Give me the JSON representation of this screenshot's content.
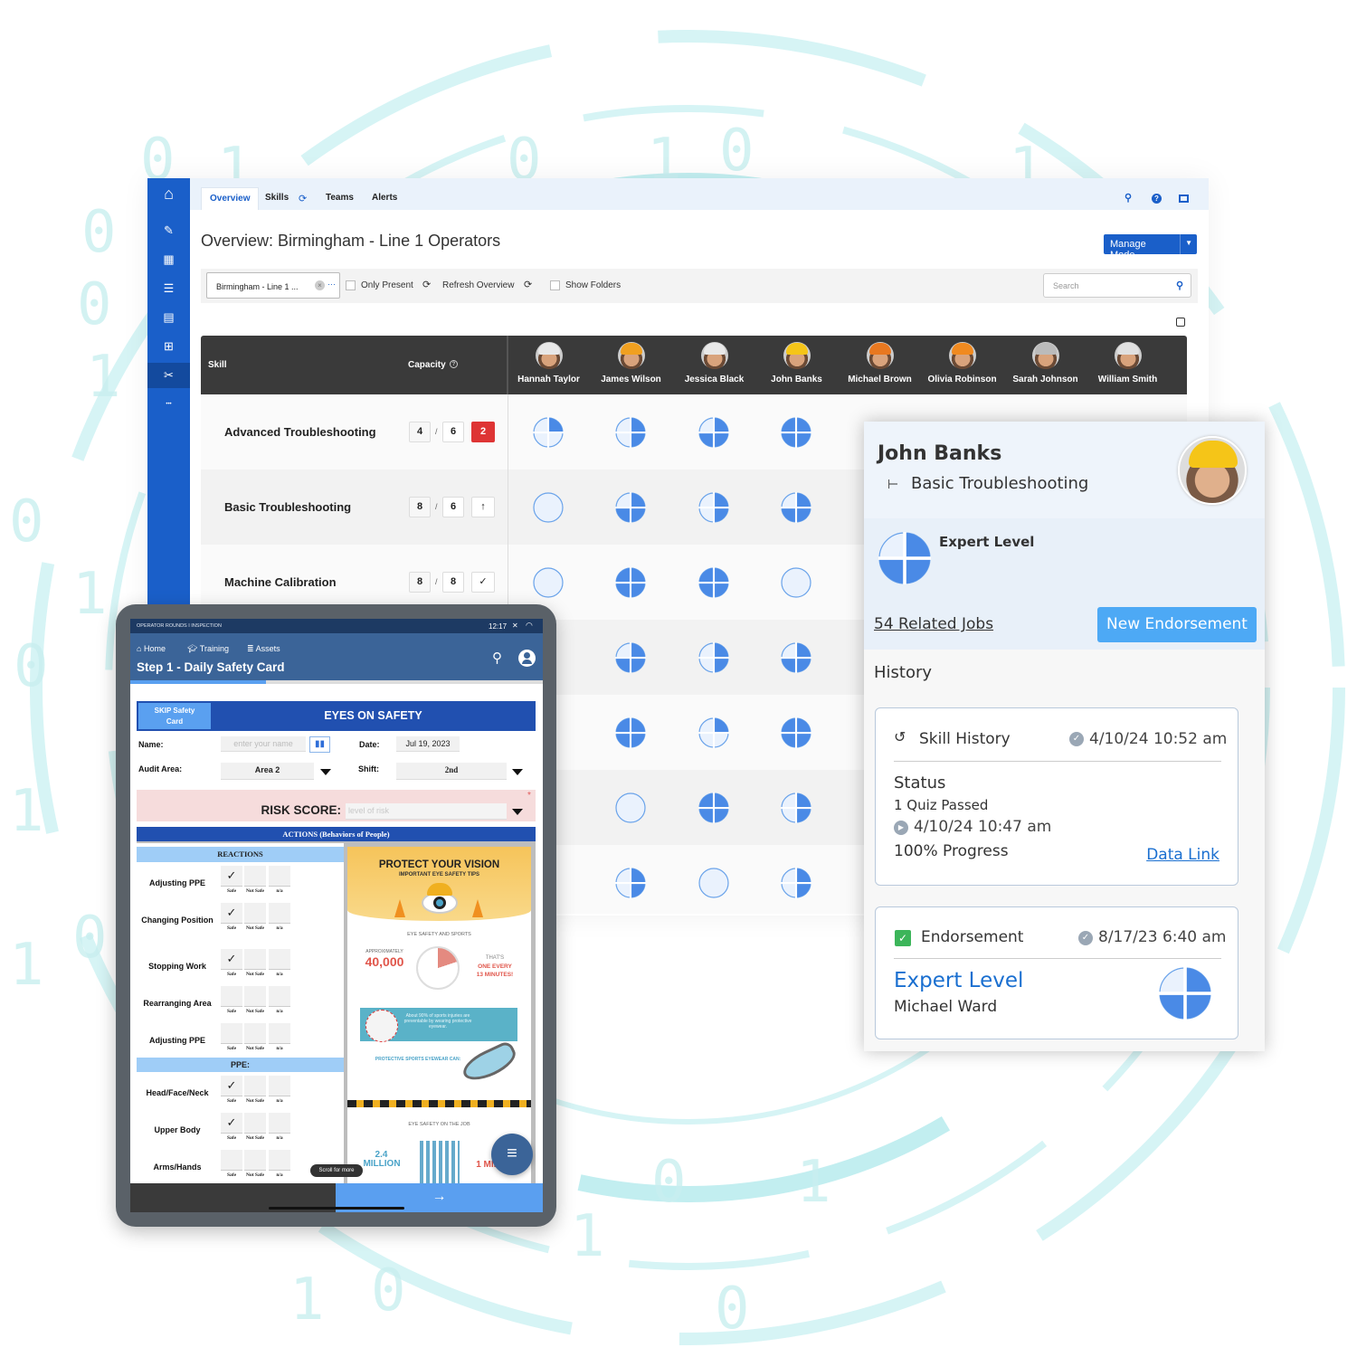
{
  "background": {
    "digits": [
      "0",
      "1",
      "0",
      "1",
      "0",
      "1",
      "0",
      "0",
      "1",
      "0",
      "1",
      "0",
      "1",
      "0",
      "1",
      "0",
      "1",
      "1",
      "0",
      "1",
      "0"
    ]
  },
  "colors": {
    "sidebar": "#1a5fc9",
    "accent": "#1a5fc9",
    "pie_fill": "#4a8ae6",
    "pie_empty": "#eaf2fd",
    "alert": "#de3434",
    "endorse_button": "#4da9f5",
    "tablet_header": "#3b6498",
    "banner": "#2150b0"
  },
  "sidebar": {
    "items": [
      {
        "icon": "home-icon"
      },
      {
        "icon": "pencil-icon"
      },
      {
        "icon": "grid-icon"
      },
      {
        "icon": "sliders-icon"
      },
      {
        "icon": "document-icon"
      },
      {
        "icon": "org-chart-icon"
      },
      {
        "icon": "tools-icon",
        "active": true
      },
      {
        "icon": "more-icon"
      }
    ]
  },
  "nav": {
    "tabs": [
      {
        "label": "Overview",
        "active": true
      },
      {
        "label": "Skills"
      },
      {
        "label": "Teams"
      },
      {
        "label": "Alerts"
      }
    ]
  },
  "header": {
    "title": "Overview: Birmingham - Line 1 Operators",
    "manage_mode": "Manage Mode"
  },
  "toolbar": {
    "location": "Birmingham - Line 1 ...",
    "only_present": "Only Present",
    "refresh": "Refresh Overview",
    "show_folders": "Show Folders",
    "search_placeholder": "Search"
  },
  "table": {
    "skill_header": "Skill",
    "capacity_header": "Capacity",
    "people": [
      {
        "name": "Hannah Taylor",
        "hat": "#e8e8e8"
      },
      {
        "name": "James Wilson",
        "hat": "#f0a020"
      },
      {
        "name": "Jessica Black",
        "hat": "#e8e8e8"
      },
      {
        "name": "John Banks",
        "hat": "#f5c518"
      },
      {
        "name": "Michael Brown",
        "hat": "#e87820"
      },
      {
        "name": "Olivia Robinson",
        "hat": "#f08a20"
      },
      {
        "name": "Sarah Johnson",
        "hat": "#bbbbbb"
      },
      {
        "name": "William Smith",
        "hat": "#e0e0e0"
      }
    ],
    "rows": [
      {
        "skill": "Advanced Troubleshooting",
        "have": "4",
        "need": "6",
        "status": "2",
        "status_type": "alert",
        "levels": [
          1,
          2,
          3,
          4,
          null,
          null,
          null,
          null
        ]
      },
      {
        "skill": "Basic Troubleshooting",
        "have": "8",
        "need": "6",
        "status": "↑",
        "status_type": "up",
        "levels": [
          0,
          3,
          2,
          3,
          null,
          null,
          null,
          null
        ]
      },
      {
        "skill": "Machine Calibration",
        "have": "8",
        "need": "8",
        "status": "✓",
        "status_type": "ok",
        "levels": [
          0,
          4,
          4,
          0,
          null,
          null,
          null,
          null
        ]
      },
      {
        "levels": [
          null,
          3,
          2,
          3,
          null,
          null,
          null,
          null
        ]
      },
      {
        "levels": [
          null,
          4,
          1,
          4,
          null,
          null,
          null,
          null
        ]
      },
      {
        "levels": [
          null,
          0,
          4,
          2,
          null,
          null,
          null,
          null
        ]
      },
      {
        "levels": [
          null,
          2,
          0,
          2,
          null,
          null,
          null,
          null
        ]
      }
    ]
  },
  "popup": {
    "name": "John Banks",
    "skill": "Basic Troubleshooting",
    "level_label": "Expert Level",
    "level": 3,
    "related_jobs": "54 Related Jobs",
    "new_endorsement": "New Endorsement",
    "history_label": "History",
    "skill_history": {
      "title": "Skill History",
      "date": "4/10/24 10:52 am",
      "status_label": "Status",
      "quiz": "1 Quiz Passed",
      "quiz_date": "4/10/24 10:47 am",
      "progress": "100% Progress",
      "data_link": "Data Link"
    },
    "endorsement": {
      "title": "Endorsement",
      "date": "8/17/23 6:40 am",
      "level": "Expert Level",
      "by": "Michael Ward",
      "level_value": 3
    }
  },
  "tablet": {
    "status_title": "OPERATOR ROUNDS I INSPECTION",
    "time": "12:17",
    "nav": [
      "Home",
      "Training",
      "Assets"
    ],
    "title": "Step 1 - Daily Safety Card",
    "progress": 0.33,
    "skip": "SKIP Safety Card",
    "banner": "EYES ON SAFETY",
    "name_label": "Name:",
    "name_placeholder": "enter your name",
    "date_label": "Date:",
    "date_value": "Jul 19, 2023",
    "area_label": "Audit Area:",
    "area_value": "Area 2",
    "shift_label": "Shift:",
    "shift_value": "2nd",
    "risk_label": "RISK SCORE:",
    "risk_placeholder": "level of risk",
    "actions": "ACTIONS (Behaviors of People)",
    "reactions_header": "REACTIONS",
    "ppe_header": "PPE:",
    "options": [
      "Safe",
      "Not Safe",
      "n/a"
    ],
    "reactions": [
      {
        "label": "Adjusting PPE",
        "checked": "Safe"
      },
      {
        "label": "Changing Position",
        "checked": "Safe"
      },
      {
        "label": "Stopping Work",
        "checked": "Safe"
      },
      {
        "label": "Rearranging Area",
        "checked": ""
      },
      {
        "label": "Adjusting PPE",
        "checked": ""
      }
    ],
    "ppe": [
      {
        "label": "Head/Face/Neck",
        "checked": "Safe"
      },
      {
        "label": "Upper Body",
        "checked": "Safe"
      },
      {
        "label": "Arms/Hands",
        "checked": ""
      }
    ],
    "scroll_hint": "Scroll for more",
    "infographic": {
      "title": "PROTECT YOUR VISION",
      "subtitle": "IMPORTANT EYE SAFETY TIPS",
      "section1": "EYE SAFETY AND SPORTS",
      "approx": "APPROXIMATELY",
      "stat1": "40,000",
      "thats": "THAT'S",
      "one_every": "ONE EVERY",
      "minutes": "13 MINUTES!",
      "stat2": "About 90% of sports injuries are preventable by wearing protective eyewear.",
      "eyewear": "PROTECTIVE SPORTS EYEWEAR CAN:",
      "section2": "EYE SAFETY ON THE JOB",
      "stat3a": "2.4",
      "stat3b": "MILLION",
      "stat4": "1 MIL"
    }
  }
}
